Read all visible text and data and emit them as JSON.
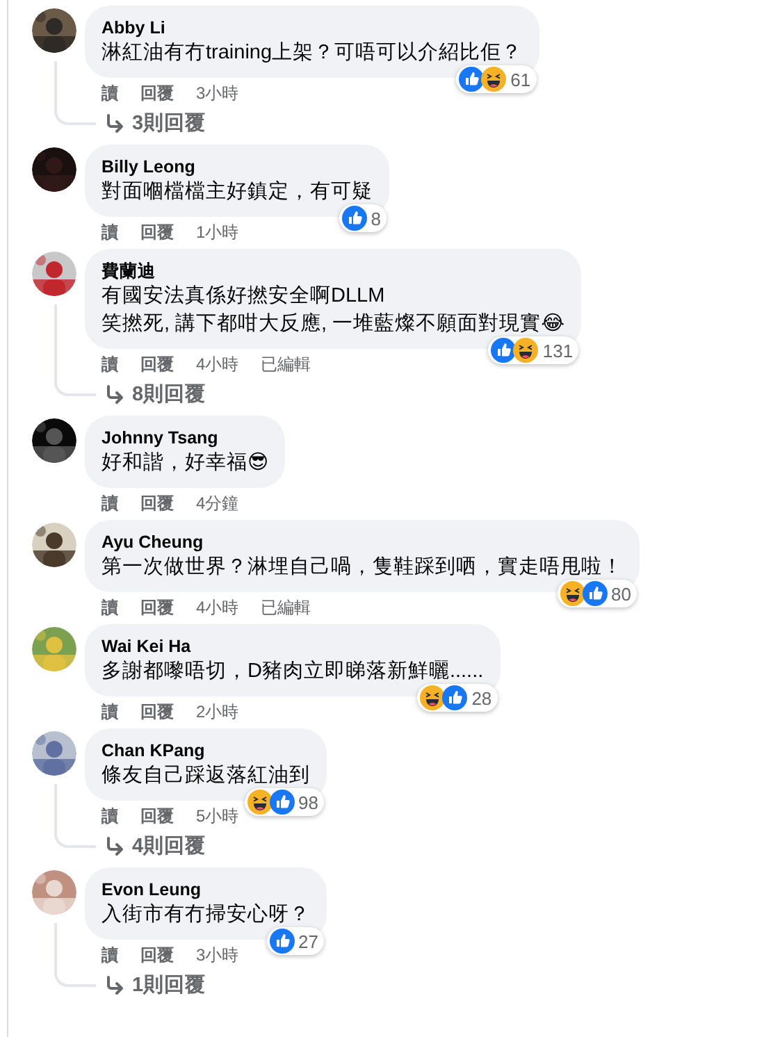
{
  "comments": [
    {
      "author": "Abby Li",
      "text": "淋紅油有冇training上架？可唔可以介紹比佢？",
      "reactions": {
        "icons": [
          {
            "kind": "like"
          },
          {
            "kind": "haha"
          }
        ],
        "count": "61"
      },
      "actions": [
        "讀",
        "回覆"
      ],
      "time": "3小時",
      "replies": "3則回覆"
    },
    {
      "author": "Billy Leong",
      "text": "對面嗰檔檔主好鎮定，有可疑",
      "reactions": {
        "icons": [
          {
            "kind": "like"
          }
        ],
        "count": "8"
      },
      "actions": [
        "讀",
        "回覆"
      ],
      "time": "1小時"
    },
    {
      "author": "費蘭迪",
      "text": "有國安法真係好撚安全啊DLLM\n笑撚死, 講下都咁大反應, 一堆藍燦不願面對現實😂",
      "reactions": {
        "icons": [
          {
            "kind": "like"
          },
          {
            "kind": "haha"
          }
        ],
        "count": "131"
      },
      "actions": [
        "讀",
        "回覆"
      ],
      "time": "4小時",
      "edited": "已編輯",
      "replies": "8則回覆"
    },
    {
      "author": "Johnny Tsang",
      "text": "好和諧，好幸福😎",
      "actions": [
        "讀",
        "回覆"
      ],
      "time": "4分鐘"
    },
    {
      "author": "Ayu Cheung",
      "text": "第一次做世界？淋埋自己喎，隻鞋踩到哂，實走唔甩啦！",
      "reactions": {
        "icons": [
          {
            "kind": "haha"
          },
          {
            "kind": "like"
          }
        ],
        "count": "80"
      },
      "actions": [
        "讀",
        "回覆"
      ],
      "time": "4小時",
      "edited": "已編輯"
    },
    {
      "author": "Wai Kei Ha",
      "text": "多謝都嚟唔切，D豬肉立即睇落新鮮曬......",
      "reactions": {
        "icons": [
          {
            "kind": "haha"
          },
          {
            "kind": "like"
          }
        ],
        "count": "28"
      },
      "actions": [
        "讀",
        "回覆"
      ],
      "time": "2小時"
    },
    {
      "author": "Chan KPang",
      "text": "條友自己踩返落紅油到",
      "reactions": {
        "icons": [
          {
            "kind": "haha"
          },
          {
            "kind": "like"
          }
        ],
        "count": "98"
      },
      "actions": [
        "讀",
        "回覆"
      ],
      "time": "5小時",
      "replies": "4則回覆"
    },
    {
      "author": "Evon Leung",
      "text": "入街市有冇掃安心呀？",
      "reactions": {
        "icons": [
          {
            "kind": "like"
          }
        ],
        "count": "27"
      },
      "actions": [
        "讀",
        "回覆"
      ],
      "time": "3小時",
      "replies": "1則回覆"
    }
  ]
}
